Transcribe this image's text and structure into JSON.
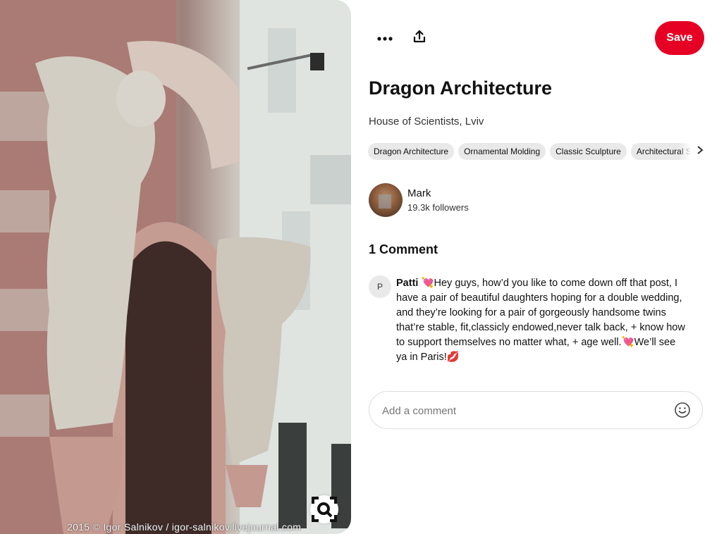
{
  "pin": {
    "watermark": "2015 © Igor Salnikov / igor-salnikov.livejournal.com",
    "lens_icon": "visual-search-icon"
  },
  "toolbar": {
    "more_icon": "more-options-icon",
    "share_icon": "share-icon",
    "save_label": "Save"
  },
  "details": {
    "title": "Dragon Architecture",
    "subtitle": "House of Scientists, Lviv",
    "tags": [
      "Dragon Architecture",
      "Ornamental Molding",
      "Classic Sculpture",
      "Architectural Sculpture"
    ],
    "tags_next_icon": "chevron-right-icon"
  },
  "creator": {
    "name": "Mark",
    "followers": "19.3k followers"
  },
  "comments": {
    "heading": "1 Comment",
    "items": [
      {
        "initial": "P",
        "author": "Patti",
        "text": "💘Hey guys, how’d you like to come down off that post, I have a pair of beautiful daughters hoping for a double wedding, and they’re looking for a pair of gorgeously handsome twins that’re stable, fit,classicly endowed,never talk back, + know how to support themselves no matter what, + age well.💘We’ll see ya in Paris!💋"
      }
    ],
    "add_placeholder": "Add a comment",
    "emoji_icon": "emoji-icon"
  },
  "colors": {
    "save_button": "#e60023",
    "chip_background": "#e9e9e9"
  }
}
